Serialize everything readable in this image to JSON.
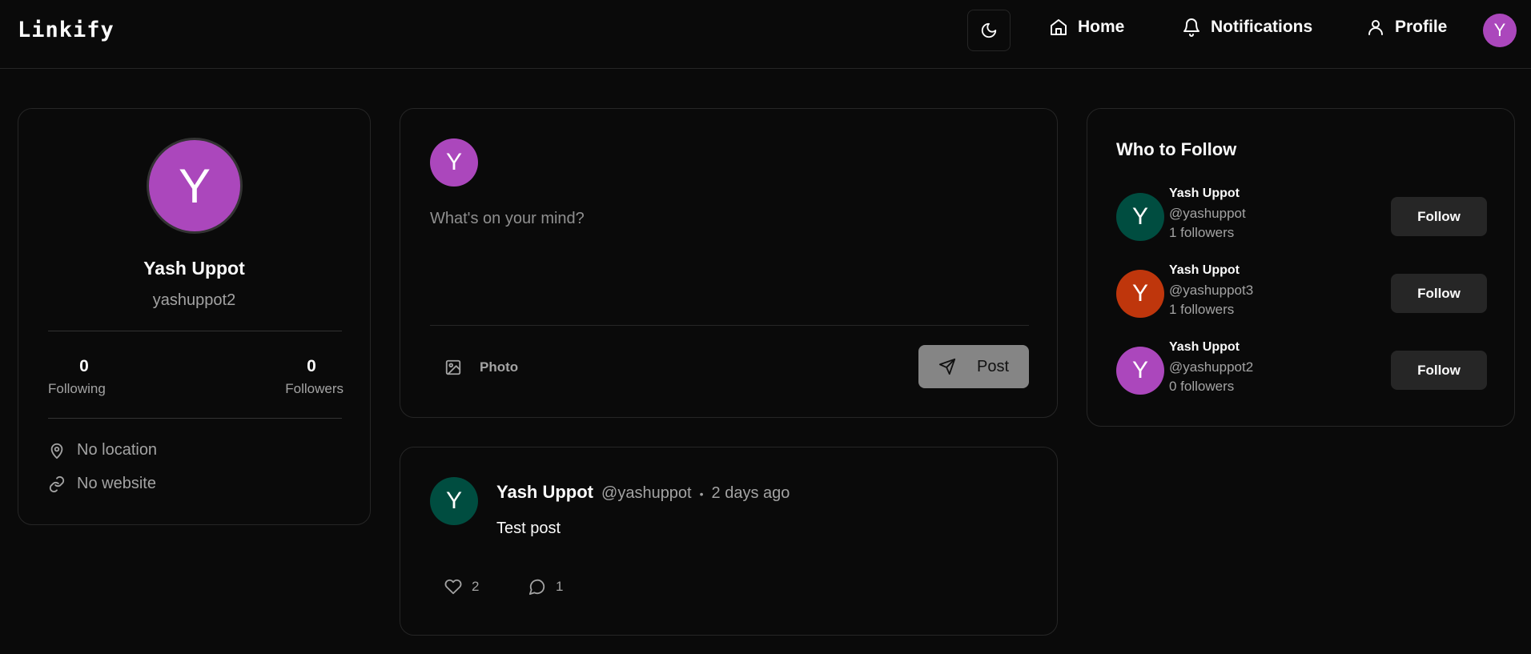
{
  "header": {
    "logo": "Linkify",
    "nav": [
      {
        "label": "Home",
        "icon": "home-icon"
      },
      {
        "label": "Notifications",
        "icon": "bell-icon"
      },
      {
        "label": "Profile",
        "icon": "user-icon"
      }
    ],
    "avatar_initial": "Y"
  },
  "profile": {
    "initial": "Y",
    "name": "Yash Uppot",
    "username": "yashuppot2",
    "following_count": "0",
    "following_label": "Following",
    "followers_count": "0",
    "followers_label": "Followers",
    "location": "No location",
    "website": "No website"
  },
  "composer": {
    "initial": "Y",
    "placeholder": "What's on your mind?",
    "photo_label": "Photo",
    "post_label": "Post"
  },
  "post": {
    "initial": "Y",
    "author": "Yash Uppot",
    "handle": "@yashuppot",
    "dot": "•",
    "time": "2 days ago",
    "content": "Test post",
    "likes": "2",
    "comments": "1"
  },
  "who_to_follow": {
    "title": "Who to Follow",
    "follow_label": "Follow",
    "users": [
      {
        "initial": "Y",
        "name": "Yash Uppot",
        "handle": "@yashuppot",
        "followers": "1 followers",
        "color": "#004d40"
      },
      {
        "initial": "Y",
        "name": "Yash Uppot",
        "handle": "@yashuppot3",
        "followers": "1 followers",
        "color": "#bf360c"
      },
      {
        "initial": "Y",
        "name": "Yash Uppot",
        "handle": "@yashuppot2",
        "followers": "0 followers",
        "color": "#ab47bc"
      }
    ]
  },
  "colors": {
    "purple": "#ab47bc",
    "green": "#004d40"
  }
}
